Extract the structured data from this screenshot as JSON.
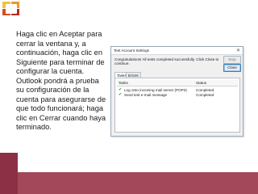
{
  "slide": {
    "logo_icon": "office-logo-icon",
    "body_text": "Haga clic en Aceptar para cerrar la ventana y, a continuación, haga clic en Siguiente para terminar de configurar la cuenta. Outlook pondrá a prueba su configuración de la cuenta para asegurarse de que todo funcionará; haga clic en Cerrar cuando haya terminado.",
    "accent_color": "#a3485a"
  },
  "dialog": {
    "title": "Test Account Settings",
    "close_glyph": "✕",
    "message": "Congratulations! All tests completed successfully. Click Close to continue.",
    "buttons": {
      "stop": "Stop",
      "close": "Close"
    },
    "tabs": [
      "Tasks",
      "Errors"
    ],
    "columns": {
      "tasks": "Tasks",
      "status": "Status"
    },
    "rows": [
      {
        "task": "Log onto incoming mail server (POP3)",
        "status": "Completed",
        "icon": "check-icon"
      },
      {
        "task": "Send test e-mail message",
        "status": "Completed",
        "icon": "check-icon"
      }
    ]
  }
}
